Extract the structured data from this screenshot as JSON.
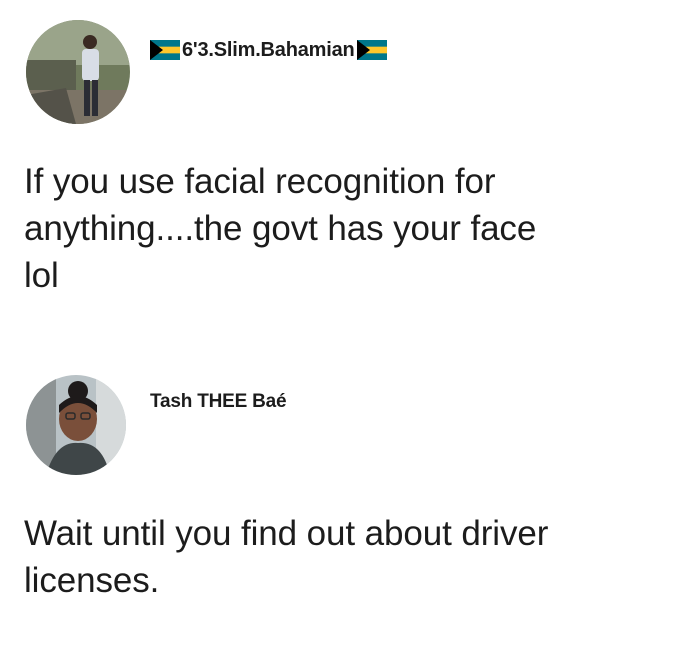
{
  "posts": [
    {
      "author": {
        "name": "6'3.Slim.Bahamian",
        "leading_icon": "bahamas-flag-icon",
        "trailing_icon": "bahamas-flag-icon"
      },
      "text_lines": [
        "If you use facial recognition for",
        "anything....the govt has your face",
        "lol"
      ]
    },
    {
      "author": {
        "name": "Tash THEE Baé"
      },
      "text_lines": [
        "Wait until you find out about driver",
        "licenses."
      ]
    }
  ],
  "colors": {
    "flag_aquamarine": "#00778b",
    "flag_gold": "#ffc72c",
    "flag_black": "#000000",
    "text": "#1c1c1c",
    "background": "#ffffff"
  }
}
